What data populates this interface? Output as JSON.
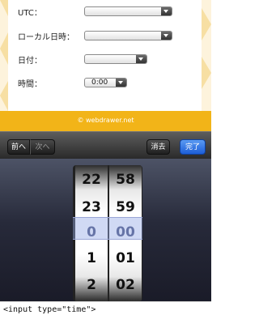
{
  "form": {
    "utc_label": "UTC：",
    "local_label": "ローカル日時：",
    "date_label": "日付：",
    "time_label": "時間：",
    "time_value": "0:00"
  },
  "footer": {
    "copyright": "© webdrawer.net"
  },
  "toolbar": {
    "prev": "前へ",
    "next": "次へ",
    "clear": "消去",
    "done": "完了"
  },
  "picker": {
    "hours": [
      "22",
      "23",
      "0",
      "1",
      "2"
    ],
    "minutes": [
      "58",
      "59",
      "00",
      "01",
      "02"
    ]
  },
  "caption": {
    "text": "<input type=\"time\">"
  },
  "colors": {
    "done_blue": "#1d5ed8",
    "footer_yellow": "#f2b418"
  }
}
